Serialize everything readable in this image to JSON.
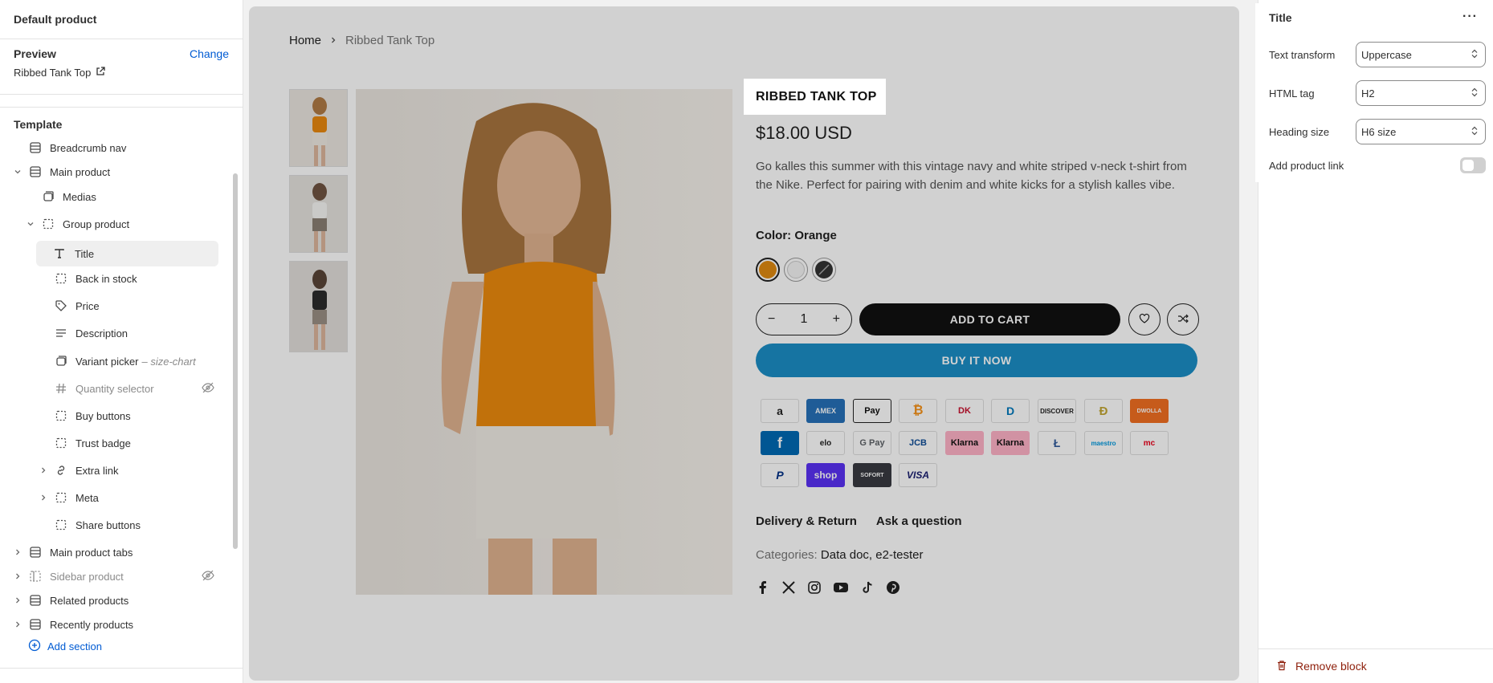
{
  "left": {
    "header": "Default product",
    "preview_label": "Preview",
    "change_label": "Change",
    "preview_value": "Ribbed Tank Top",
    "template_label": "Template",
    "items": {
      "breadcrumb": "Breadcrumb nav",
      "main_product": "Main product",
      "medias": "Medias",
      "group_product": "Group product",
      "title": "Title",
      "back_in_stock": "Back in stock",
      "price": "Price",
      "description": "Description",
      "variant_picker": "Variant picker",
      "variant_picker_sub": "– size-chart",
      "quantity_selector": "Quantity selector",
      "buy_buttons": "Buy buttons",
      "trust_badge": "Trust badge",
      "extra_link": "Extra link",
      "meta": "Meta",
      "share_buttons": "Share buttons",
      "main_product_tabs": "Main product tabs",
      "sidebar_product": "Sidebar product",
      "related_products": "Related products",
      "recently_products": "Recently products"
    },
    "add_section": "Add section"
  },
  "canvas": {
    "breadcrumb_home": "Home",
    "breadcrumb_current": "Ribbed Tank Top",
    "product_title": "RIBBED TANK TOP",
    "price": "$18.00 USD",
    "description": "Go kalles this summer with this vintage navy and white striped v-neck t-shirt from the Nike. Perfect for pairing with denim and white kicks for a stylish kalles vibe.",
    "color_label": "Color: Orange",
    "qty_minus": "−",
    "qty_value": "1",
    "qty_plus": "+",
    "add_to_cart": "ADD TO CART",
    "buy_now": "BUY IT NOW",
    "tab_delivery": "Delivery & Return",
    "tab_ask": "Ask a question",
    "categories_label": "Categories:",
    "categories_value": "Data doc, e2-tester",
    "payments": [
      "a",
      "AMEX",
      "Pay",
      "₿",
      "DK",
      "D",
      "DISCOVER",
      "Ð",
      "DWOLLA",
      "f",
      "elo",
      "G Pay",
      "JCB",
      "Klarna",
      "Klarna",
      "Ł",
      "maestro",
      "mc",
      "P",
      "shop",
      "SOFORT",
      "VISA"
    ]
  },
  "right": {
    "title": "Title",
    "text_transform_label": "Text transform",
    "text_transform_value": "Uppercase",
    "html_tag_label": "HTML tag",
    "html_tag_value": "H2",
    "heading_size_label": "Heading size",
    "heading_size_value": "H6 size",
    "add_product_link_label": "Add product link",
    "remove_block": "Remove block"
  },
  "colors": {
    "accent": "#005bd3",
    "buy_now": "#1b8ec6",
    "danger": "#8e1f0b",
    "swatch_orange": "#e08a12"
  }
}
